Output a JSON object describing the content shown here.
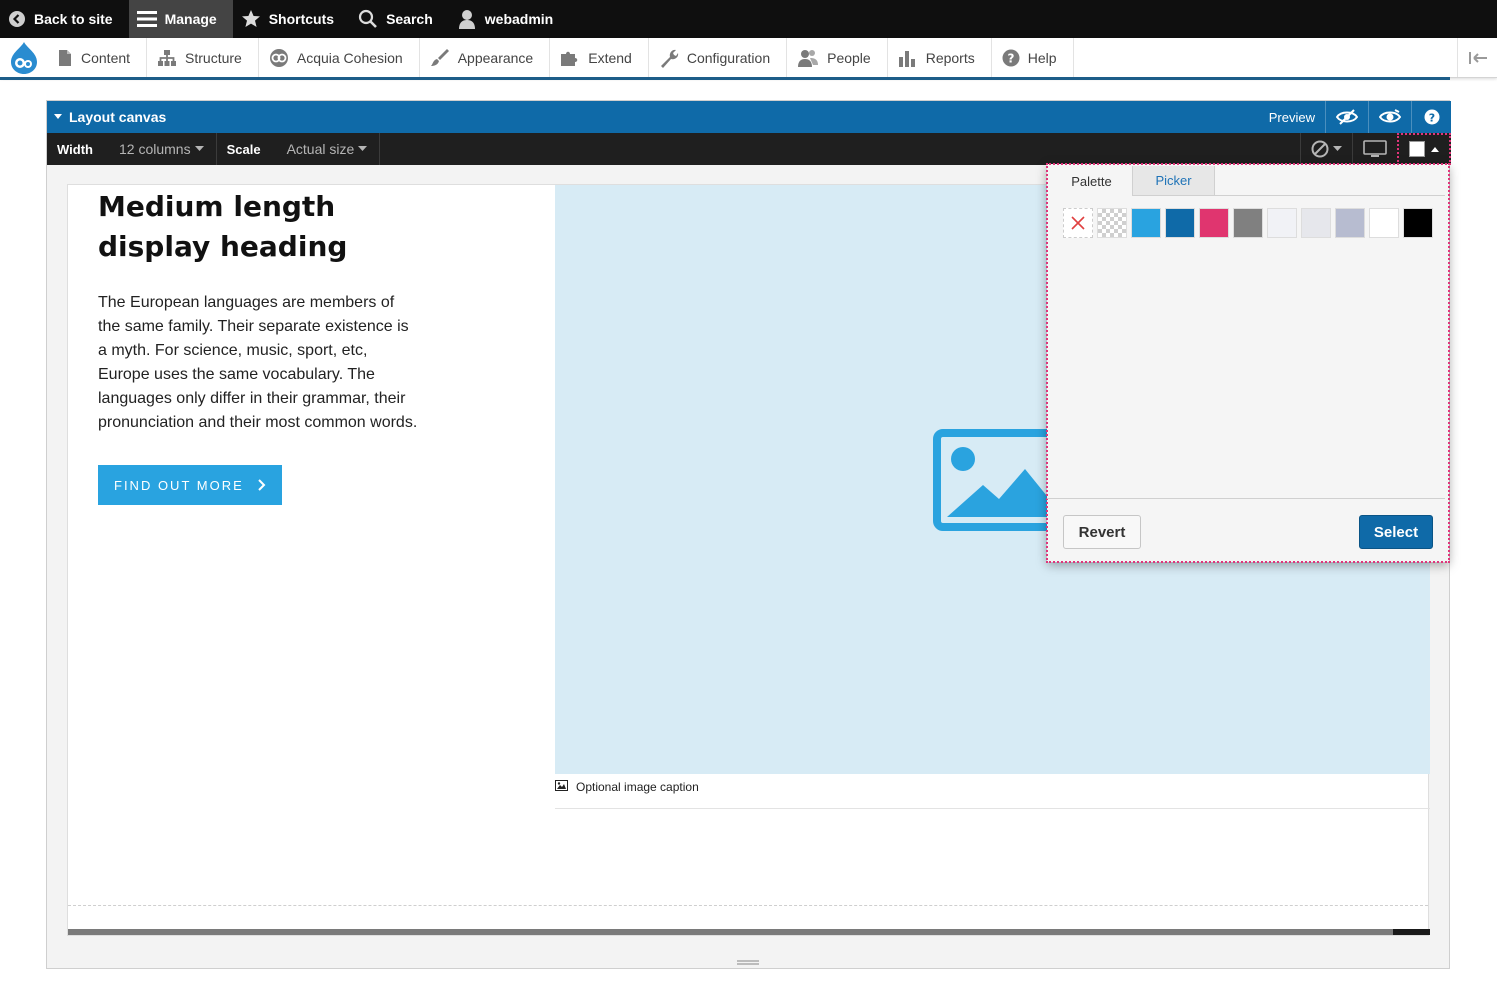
{
  "toolbar": {
    "back_to_site": "Back to site",
    "manage": "Manage",
    "shortcuts": "Shortcuts",
    "search": "Search",
    "user": "webadmin"
  },
  "admin_menu": {
    "items": [
      {
        "label": "Content",
        "icon": "file-icon"
      },
      {
        "label": "Structure",
        "icon": "sitemap-icon"
      },
      {
        "label": "Acquia Cohesion",
        "icon": "cohesion-icon"
      },
      {
        "label": "Appearance",
        "icon": "paintbrush-icon"
      },
      {
        "label": "Extend",
        "icon": "puzzle-icon"
      },
      {
        "label": "Configuration",
        "icon": "wrench-icon"
      },
      {
        "label": "People",
        "icon": "people-icon"
      },
      {
        "label": "Reports",
        "icon": "bar-chart-icon"
      },
      {
        "label": "Help",
        "icon": "help-icon"
      }
    ]
  },
  "canvas": {
    "title": "Layout canvas",
    "preview_label": "Preview",
    "width_label": "Width",
    "width_value": "12 columns",
    "scale_label": "Scale",
    "scale_value": "Actual size"
  },
  "content": {
    "heading": "Medium length display heading",
    "body": "The European languages are members of the same family. Their separate existence is a myth. For science, music, sport, etc, Europe uses the same vocabulary. The languages only differ in their grammar, their pronunciation and their most common words.",
    "cta_label": "FIND OUT MORE",
    "caption": "Optional image caption"
  },
  "color_picker": {
    "tabs": [
      "Palette",
      "Picker"
    ],
    "active_tab": "Palette",
    "swatches": [
      "#29a3e0",
      "#0f6aa8",
      "#e0356f",
      "#808080",
      "#f1f2f6",
      "#e6e7ec",
      "#b7bcd0",
      "#ffffff",
      "#000000"
    ],
    "revert_label": "Revert",
    "select_label": "Select"
  },
  "colors": {
    "accent": "#0f6aa8",
    "cta": "#29a3e0",
    "highlight": "#e0357a"
  }
}
